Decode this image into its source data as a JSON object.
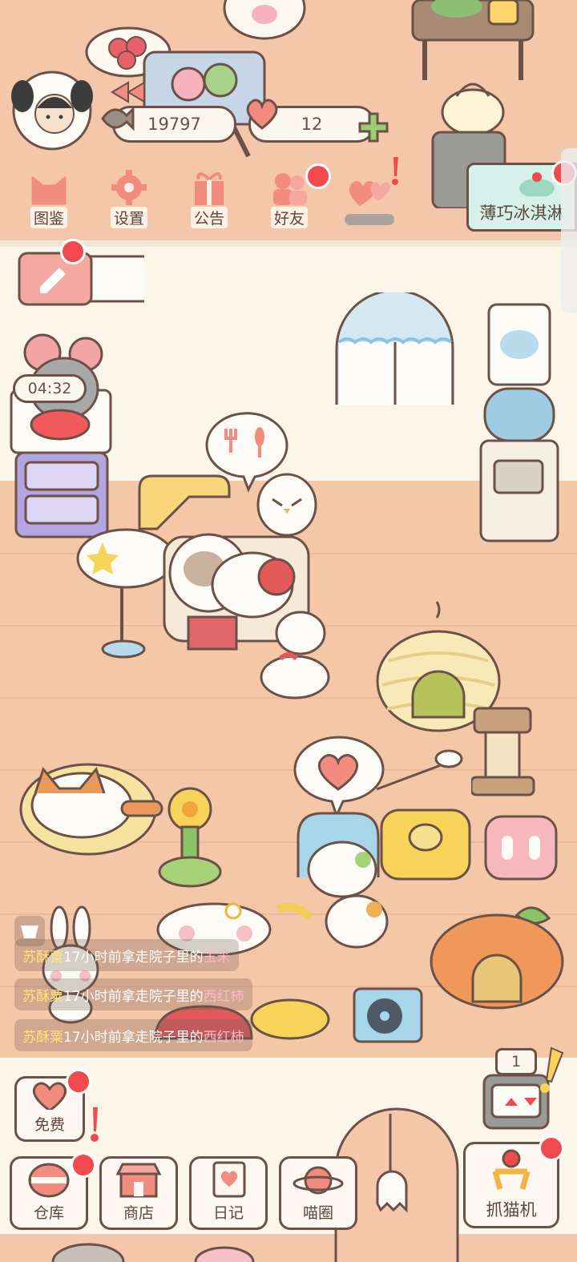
{
  "currency": {
    "fish": "19797",
    "hearts": "12"
  },
  "top_menu": [
    {
      "label": "图鉴",
      "icon": "cat-face-icon"
    },
    {
      "label": "设置",
      "icon": "gear-icon"
    },
    {
      "label": "公告",
      "icon": "gift-icon"
    },
    {
      "label": "好友",
      "icon": "friends-icon"
    },
    {
      "label": "",
      "icon": "hearts-icon"
    }
  ],
  "promo_sign": "薄巧冰淇淋",
  "timer": "04:32",
  "activity_log": [
    {
      "name": "苏酥粟",
      "middle": "17小时前拿走院子里的",
      "item": "玉米"
    },
    {
      "name": "苏酥粟",
      "middle": "17小时前拿走院子里的",
      "item": "西红柿"
    },
    {
      "name": "苏酥粟",
      "middle": "17小时前拿走院子里的",
      "item": "西红柿"
    }
  ],
  "free_button": "免费",
  "bottom_nav": [
    {
      "label": "仓库",
      "icon": "basket-icon"
    },
    {
      "label": "商店",
      "icon": "shop-icon"
    },
    {
      "label": "日记",
      "icon": "diary-icon"
    },
    {
      "label": "喵圈",
      "icon": "planet-cat-icon"
    }
  ],
  "claw_machine": {
    "label": "抓猫机",
    "count": "1"
  },
  "colors": {
    "badge": "#f04a4f",
    "outline": "#6b5147",
    "floor": "#f5c7a9",
    "wall": "#fbf5ea",
    "accent_pink": "#f28b80"
  }
}
